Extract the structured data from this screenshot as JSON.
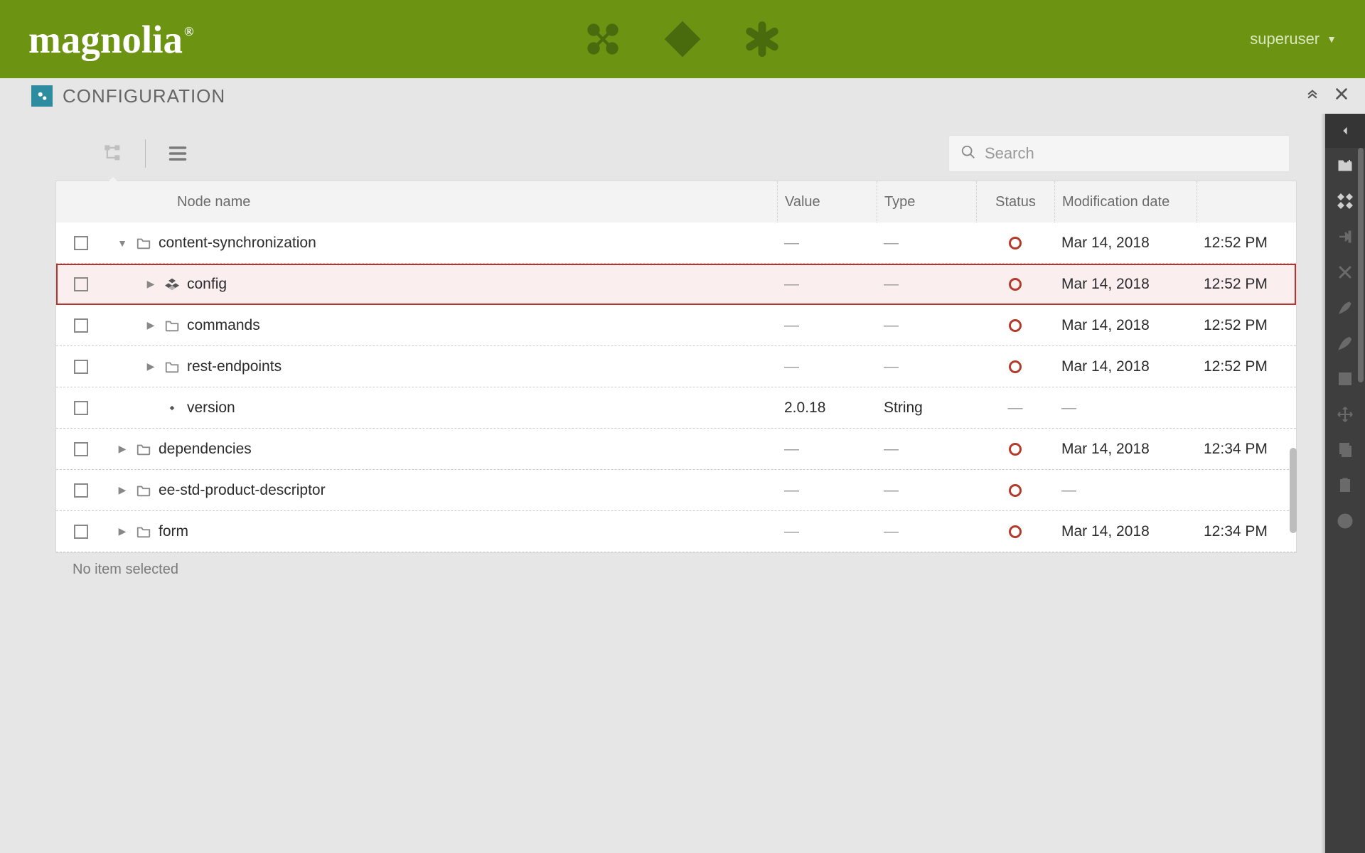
{
  "header": {
    "brand": "magnolia",
    "username": "superuser"
  },
  "subapp": {
    "title": "CONFIGURATION"
  },
  "search": {
    "placeholder": "Search"
  },
  "columns": {
    "name": "Node name",
    "value": "Value",
    "type": "Type",
    "status": "Status",
    "date": "Modification date"
  },
  "rows": [
    {
      "indent": 0,
      "expander": "down",
      "icon": "folder",
      "name": "content-synchronization",
      "value": "—",
      "type": "—",
      "status": "red",
      "date": "Mar 14, 2018",
      "time": "12:52 PM",
      "highlight": false
    },
    {
      "indent": 1,
      "expander": "right",
      "icon": "module",
      "name": "config",
      "value": "—",
      "type": "—",
      "status": "red",
      "date": "Mar 14, 2018",
      "time": "12:52 PM",
      "highlight": true
    },
    {
      "indent": 1,
      "expander": "right",
      "icon": "folder",
      "name": "commands",
      "value": "—",
      "type": "—",
      "status": "red",
      "date": "Mar 14, 2018",
      "time": "12:52 PM",
      "highlight": false
    },
    {
      "indent": 1,
      "expander": "right",
      "icon": "folder",
      "name": "rest-endpoints",
      "value": "—",
      "type": "—",
      "status": "red",
      "date": "Mar 14, 2018",
      "time": "12:52 PM",
      "highlight": false
    },
    {
      "indent": 1,
      "expander": "none",
      "icon": "property",
      "name": "version",
      "value": "2.0.18",
      "type": "String",
      "status": "none",
      "date": "—",
      "time": "",
      "highlight": false
    },
    {
      "indent": 0,
      "expander": "right",
      "icon": "folder",
      "name": "dependencies",
      "value": "—",
      "type": "—",
      "status": "red",
      "date": "Mar 14, 2018",
      "time": "12:34 PM",
      "highlight": false
    },
    {
      "indent": 0,
      "expander": "right",
      "icon": "folder",
      "name": "ee-std-product-descriptor",
      "value": "—",
      "type": "—",
      "status": "red",
      "date": "—",
      "time": "",
      "highlight": false
    },
    {
      "indent": 0,
      "expander": "right",
      "icon": "folder",
      "name": "form",
      "value": "—",
      "type": "—",
      "status": "red",
      "date": "Mar 14, 2018",
      "time": "12:34 PM",
      "highlight": false
    }
  ],
  "status": "No item selected",
  "actions": [
    {
      "name": "add-folder",
      "disabled": false
    },
    {
      "name": "add-node",
      "disabled": false
    },
    {
      "name": "import",
      "disabled": true
    },
    {
      "name": "delete",
      "disabled": true
    },
    {
      "name": "edit-a",
      "disabled": true
    },
    {
      "name": "edit-b",
      "disabled": true
    },
    {
      "name": "book",
      "disabled": true
    },
    {
      "name": "move",
      "disabled": true
    },
    {
      "name": "copy",
      "disabled": true
    },
    {
      "name": "paste",
      "disabled": true
    },
    {
      "name": "info",
      "disabled": true
    }
  ]
}
